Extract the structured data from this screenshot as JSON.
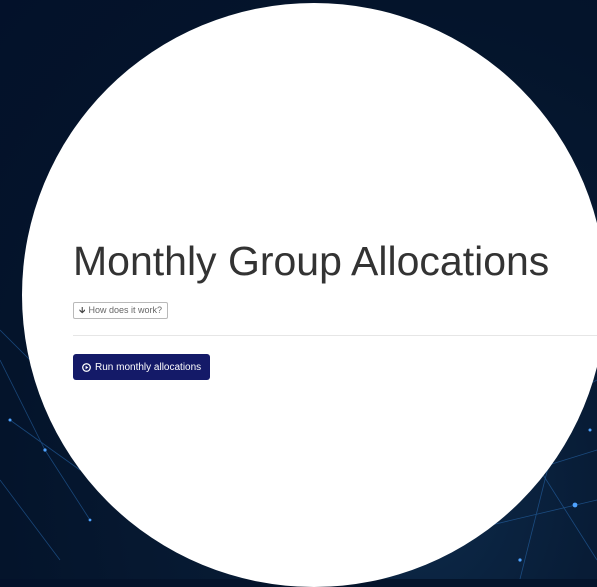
{
  "page": {
    "title": "Monthly Group Allocations"
  },
  "help": {
    "label": "How does it work?",
    "icon": "arrow-down-icon"
  },
  "actions": {
    "run_label": "Run monthly allocations",
    "run_icon": "play-circle-icon",
    "run_color": "#141a68"
  },
  "background": {
    "color": "#04142b",
    "accent": "#2a7fd4"
  }
}
